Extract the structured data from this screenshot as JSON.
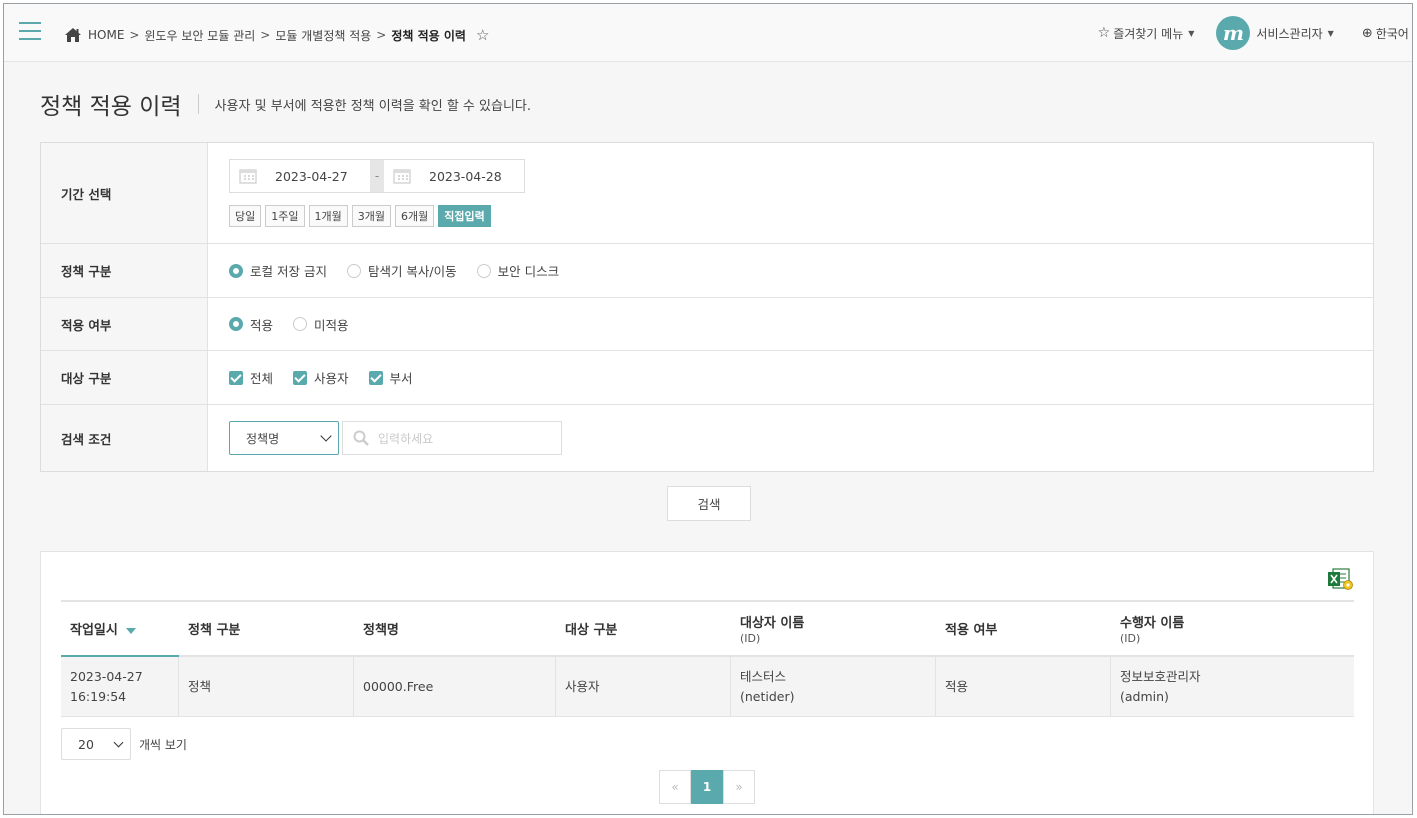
{
  "breadcrumb": {
    "home": "HOME",
    "items": [
      "윈도우 보안 모듈 관리",
      "모듈 개별정책 적용"
    ],
    "current": "정책 적용 이력",
    "separator": ">"
  },
  "topbar": {
    "favorites_label": "즐겨찾기 메뉴",
    "avatar_letter": "m",
    "user_label": "서비스관리자",
    "language_label": "한국어"
  },
  "page": {
    "title": "정책 적용 이력",
    "description": "사용자 및 부서에 적용한 정책 이력을 확인 할 수 있습니다."
  },
  "form": {
    "period_label": "기간 선택",
    "date_from": "2023-04-27",
    "date_sep": "-",
    "date_to": "2023-04-28",
    "quick_ranges": [
      "당일",
      "1주일",
      "1개월",
      "3개월",
      "6개월",
      "직접입력"
    ],
    "quick_selected": "직접입력",
    "policy_type_label": "정책 구분",
    "policy_types": [
      "로컬 저장 금지",
      "탐색기 복사/이동",
      "보안 디스크"
    ],
    "policy_type_selected": "로컬 저장 금지",
    "apply_label": "적용 여부",
    "apply_options": [
      "적용",
      "미적용"
    ],
    "apply_selected": "적용",
    "target_label": "대상 구분",
    "targets": [
      "전체",
      "사용자",
      "부서"
    ],
    "search_label": "검색 조건",
    "search_field_selected": "정책명",
    "search_placeholder": "입력하세요",
    "search_button": "검색"
  },
  "table": {
    "headers": [
      {
        "label": "작업일시",
        "sub": ""
      },
      {
        "label": "정책 구분",
        "sub": ""
      },
      {
        "label": "정책명",
        "sub": ""
      },
      {
        "label": "대상 구분",
        "sub": ""
      },
      {
        "label": "대상자 이름",
        "sub": "(ID)"
      },
      {
        "label": "적용 여부",
        "sub": ""
      },
      {
        "label": "수행자 이름",
        "sub": "(ID)"
      }
    ],
    "rows": [
      {
        "date": "2023-04-27",
        "time": "16:19:54",
        "policy_type": "정책",
        "policy_name": "00000.Free",
        "target_type": "사용자",
        "target_name": "테스터스",
        "target_id": "(netider)",
        "applied": "적용",
        "actor_name": "정보보호관리자",
        "actor_id": "(admin)"
      }
    ]
  },
  "paging": {
    "page_size": "20",
    "page_size_label": "개씩 보기",
    "prev": "«",
    "current": "1",
    "next": "»"
  },
  "colors": {
    "accent": "#5aa9ad"
  }
}
